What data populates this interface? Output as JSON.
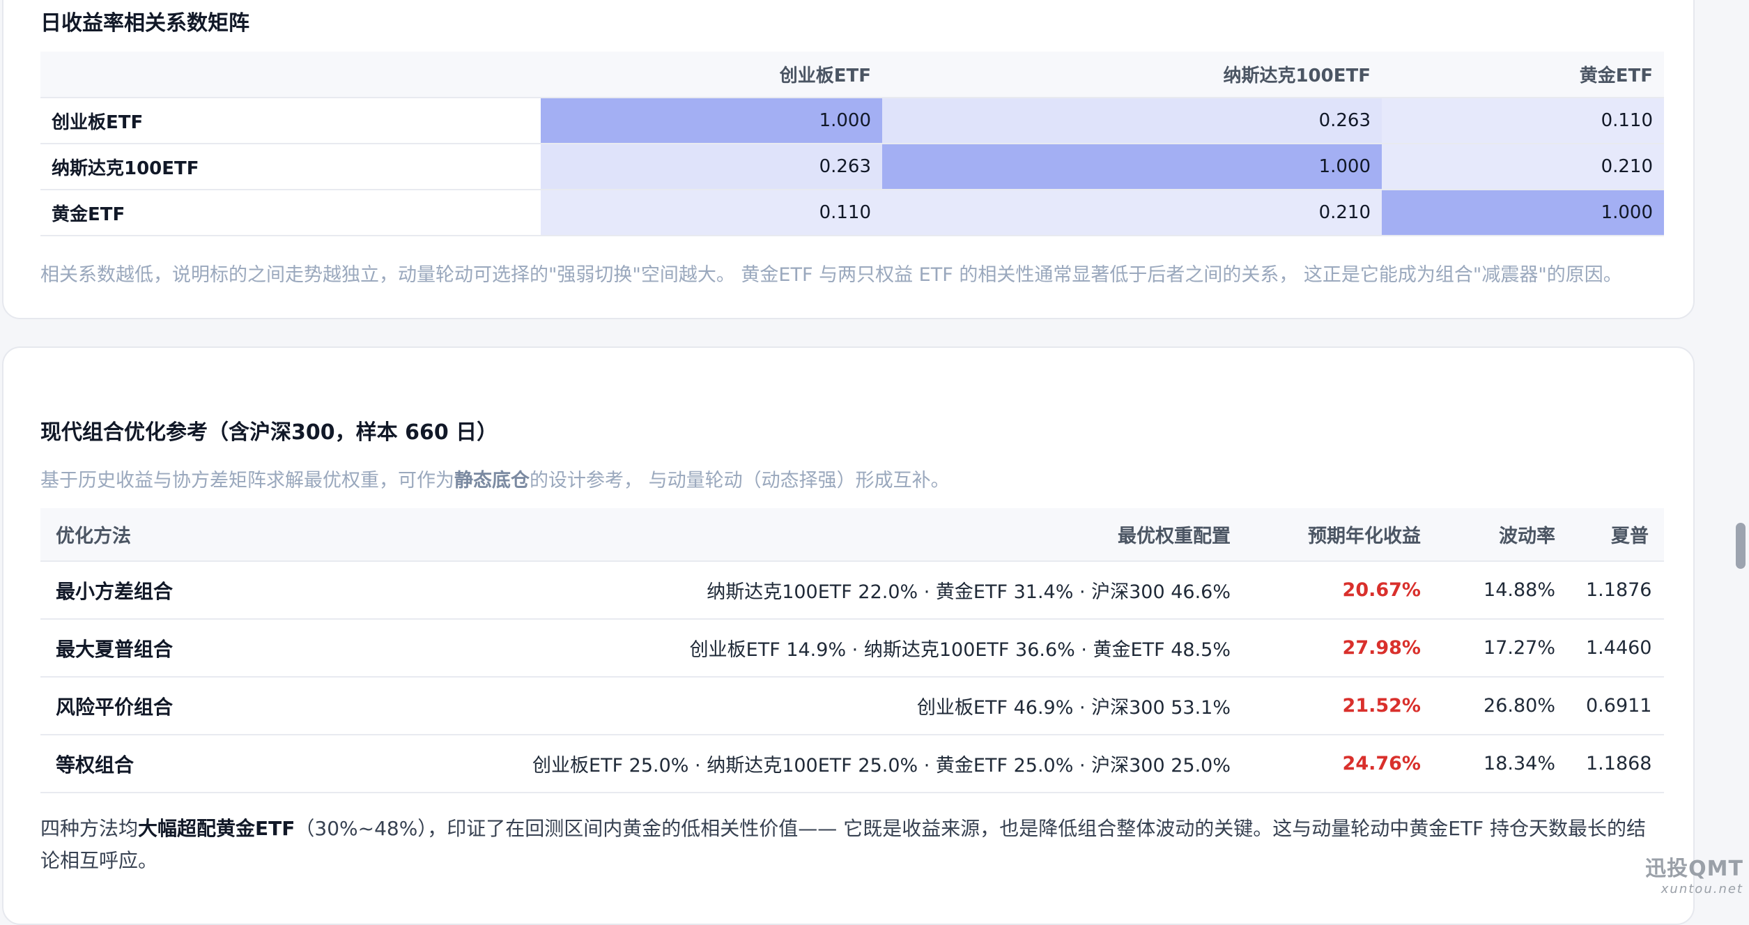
{
  "correlation": {
    "title": "日收益率相关系数矩阵",
    "columns": [
      "创业板ETF",
      "纳斯达克100ETF",
      "黄金ETF"
    ],
    "rows": [
      {
        "name": "创业板ETF",
        "values": [
          "1.000",
          "0.263",
          "0.110"
        ]
      },
      {
        "name": "纳斯达克100ETF",
        "values": [
          "0.263",
          "1.000",
          "0.210"
        ]
      },
      {
        "name": "黄金ETF",
        "values": [
          "0.110",
          "0.210",
          "1.000"
        ]
      }
    ],
    "note": "相关系数越低，说明标的之间走势越独立，动量轮动可选择的\"强弱切换\"空间越大。 黄金ETF 与两只权益 ETF 的相关性通常显著低于后者之间的关系， 这正是它能成为组合\"减震器\"的原因。",
    "colors": {
      "diag": "#a3aff3",
      "mid": "#dfe3fa",
      "low": "#e6e9fb"
    }
  },
  "optimization": {
    "title": "现代组合优化参考（含沪深300，样本 660 日）",
    "subtitle_pre": "基于历史收益与协方差矩阵求解最优权重，可作为",
    "subtitle_bold": "静态底仓",
    "subtitle_post": "的设计参考， 与动量轮动（动态择强）形成互补。",
    "headers": [
      "优化方法",
      "最优权重配置",
      "预期年化收益",
      "波动率",
      "夏普"
    ],
    "rows": [
      {
        "method": "最小方差组合",
        "weights": "纳斯达克100ETF 22.0% · 黄金ETF 31.4% · 沪深300 46.6%",
        "ret": "20.67%",
        "vol": "14.88%",
        "sharpe": "1.1876"
      },
      {
        "method": "最大夏普组合",
        "weights": "创业板ETF 14.9% · 纳斯达克100ETF 36.6% · 黄金ETF 48.5%",
        "ret": "27.98%",
        "vol": "17.27%",
        "sharpe": "1.4460"
      },
      {
        "method": "风险平价组合",
        "weights": "创业板ETF 46.9% · 沪深300 53.1%",
        "ret": "21.52%",
        "vol": "26.80%",
        "sharpe": "0.6911"
      },
      {
        "method": "等权组合",
        "weights": "创业板ETF 25.0% · 纳斯达克100ETF 25.0% · 黄金ETF 25.0% · 沪深300 25.0%",
        "ret": "24.76%",
        "vol": "18.34%",
        "sharpe": "1.1868"
      }
    ],
    "conclusion_pre": "四种方法均",
    "conclusion_bold": "大幅超配黄金ETF",
    "conclusion_post": "（30%~48%），印证了在回测区间内黄金的低相关性价值—— 它既是收益来源，也是降低组合整体波动的关键。这与动量轮动中黄金ETF 持仓天数最长的结论相互呼应。",
    "return_color": "#d9302c"
  },
  "watermark": {
    "brand": "迅投QMT",
    "site": "xuntou.net"
  }
}
